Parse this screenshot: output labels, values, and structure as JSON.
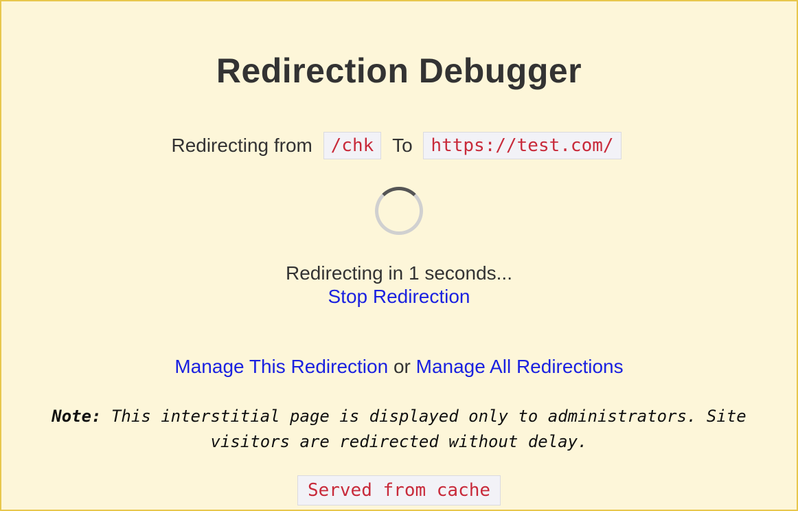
{
  "title": "Redirection Debugger",
  "redirect": {
    "from_label": "Redirecting from",
    "from_value": "/chk",
    "to_label": "To",
    "to_value": "https://test.com/"
  },
  "countdown_text": "Redirecting in 1 seconds...",
  "stop_label": "Stop Redirection",
  "manage": {
    "this_label": "Manage This Redirection",
    "or_label": " or ",
    "all_label": "Manage All Redirections"
  },
  "note": {
    "label": "Note:",
    "text": " This interstitial page is displayed only to administrators. Site visitors are redirected without delay."
  },
  "cache_label": "Served from cache"
}
